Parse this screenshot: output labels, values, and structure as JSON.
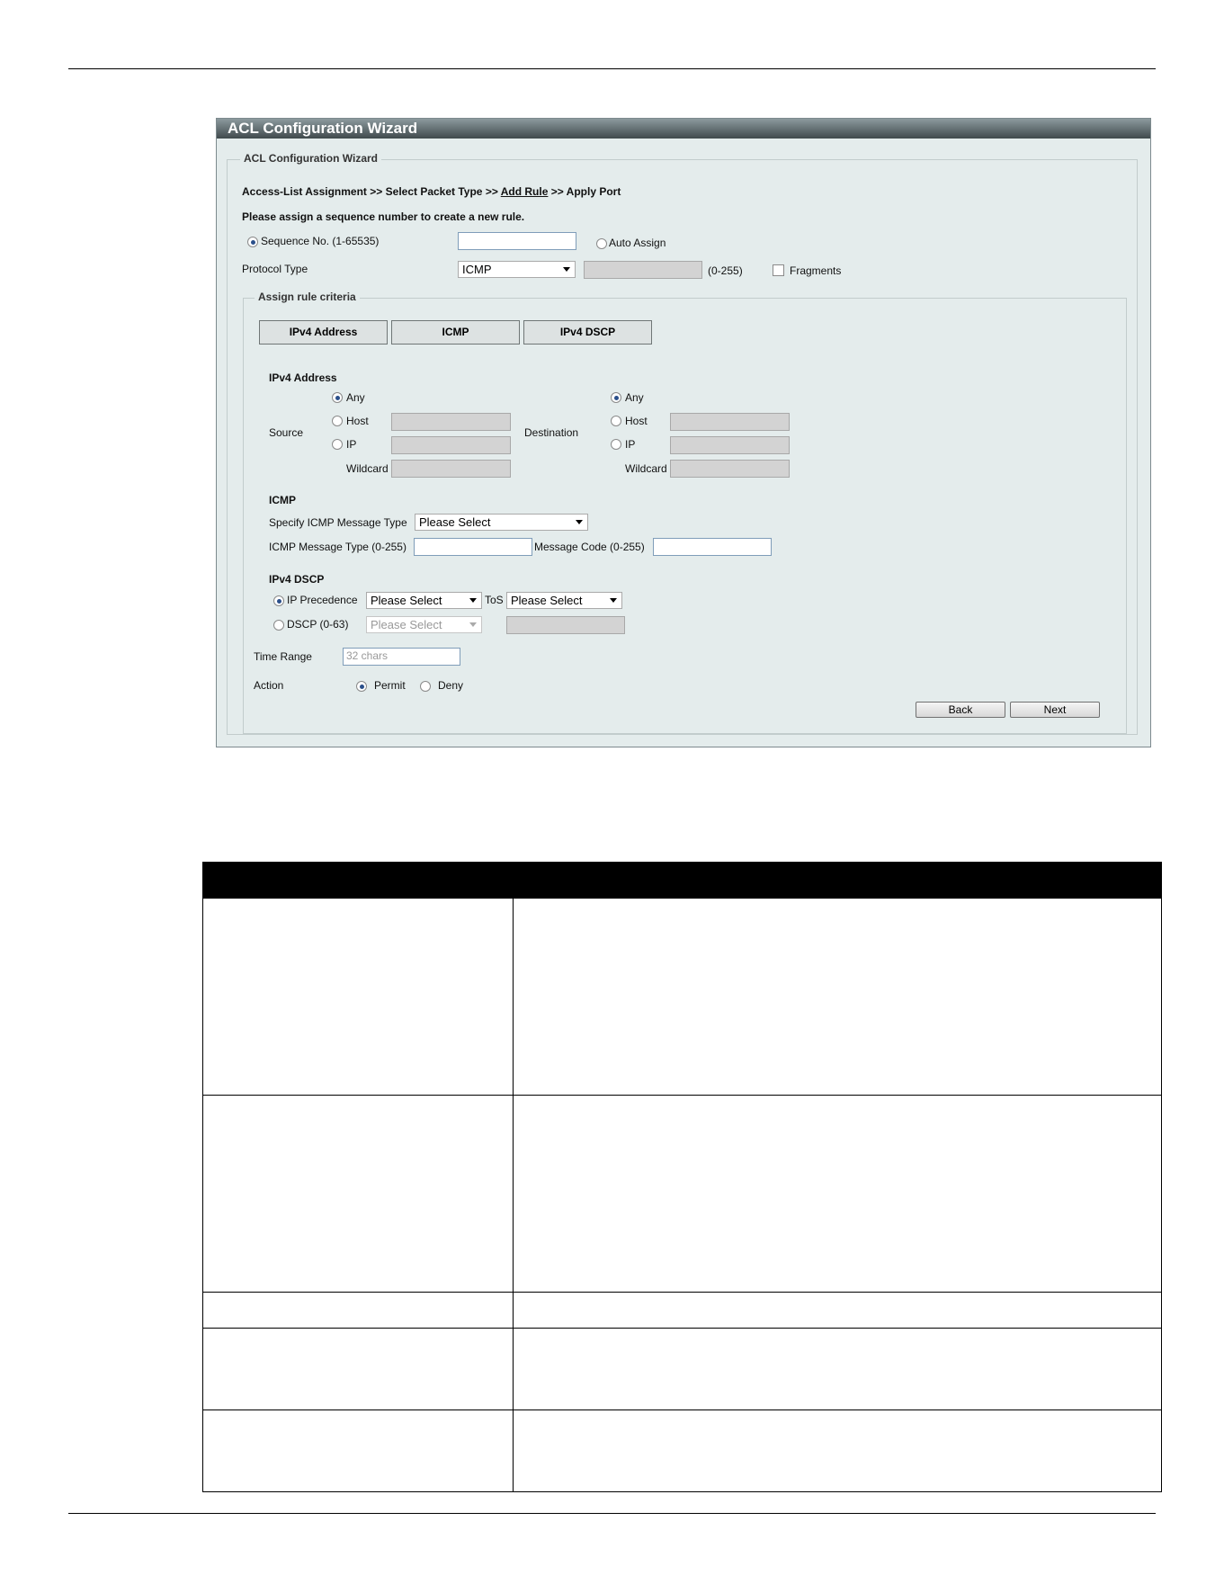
{
  "wizard": {
    "title": "ACL Configuration Wizard",
    "fieldset_legend": "ACL Configuration Wizard",
    "breadcrumb": {
      "step1": "Access-List Assignment",
      "sep1": ">>",
      "step2": "Select Packet Type",
      "sep2": ">>",
      "step3": "Add Rule",
      "sep3": ">>",
      "step4": "Apply Port"
    },
    "instruction": "Please assign a sequence number to create a new rule.",
    "sequence": {
      "label": "Sequence No. (1-65535)",
      "value": "",
      "auto_label": "Auto Assign"
    },
    "protocol": {
      "label": "Protocol Type",
      "selected": "ICMP",
      "range": "(0-255)",
      "fragments_label": "Fragments"
    },
    "criteria": {
      "legend": "Assign rule criteria",
      "tabs": [
        "IPv4 Address",
        "ICMP",
        "IPv4 DSCP"
      ]
    },
    "ipv4": {
      "heading": "IPv4 Address",
      "source_label": "Source",
      "destination_label": "Destination",
      "any": "Any",
      "host": "Host",
      "ip": "IP",
      "wildcard": "Wildcard"
    },
    "icmp": {
      "heading": "ICMP",
      "specify_label": "Specify ICMP Message Type",
      "specify_selected": "Please Select",
      "type_label": "ICMP Message Type (0-255)",
      "code_label": "Message Code (0-255)"
    },
    "dscp": {
      "heading": "IPv4 DSCP",
      "precedence_label": "IP Precedence",
      "precedence_selected": "Please Select",
      "tos_label": "ToS",
      "tos_selected": "Please Select",
      "dscp_label": "DSCP (0-63)",
      "dscp_selected": "Please Select"
    },
    "time_range": {
      "label": "Time Range",
      "placeholder": "32 chars"
    },
    "action": {
      "label": "Action",
      "permit": "Permit",
      "deny": "Deny"
    },
    "buttons": {
      "back": "Back",
      "next": "Next"
    }
  }
}
